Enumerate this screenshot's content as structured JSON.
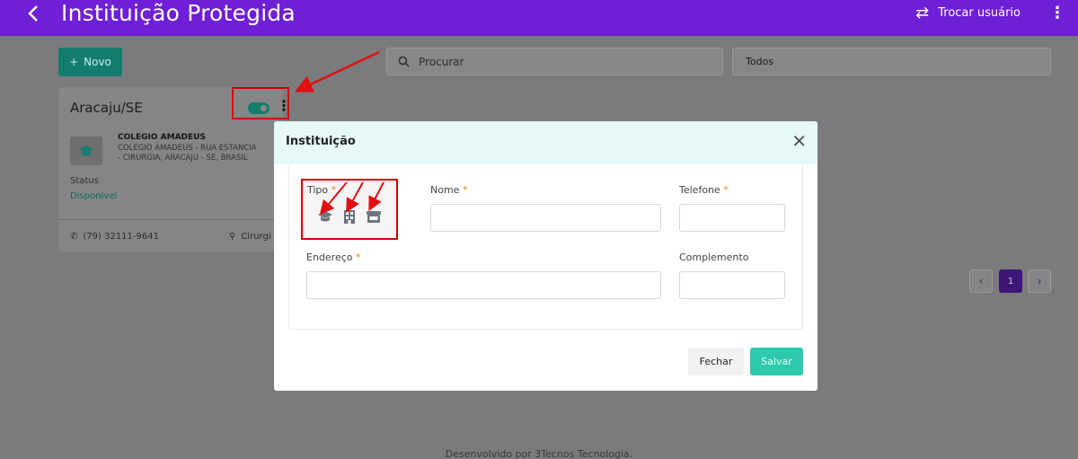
{
  "header": {
    "title": "Instituição Protegida",
    "switch_user": "Trocar usuário"
  },
  "toolbar": {
    "new_label": "Novo",
    "search_placeholder": "Procurar",
    "filter_value": "Todos"
  },
  "card": {
    "title": "Aracaju/SE",
    "institution_name": "COLEGIO AMADEUS",
    "institution_address": "COLEGIO AMADEUS - RUA ESTANCIA",
    "institution_address_2": "- CIRURGIA, ARACAJU - SE, BRASIL",
    "status_label": "Status",
    "status_value": "Disponível",
    "phone": "(79) 32111-9641",
    "city": "Cirurgi"
  },
  "pagination": {
    "current": "1"
  },
  "footer": {
    "text": "Desenvolvido por 3Tecnos Tecnologia."
  },
  "modal": {
    "title": "Instituição",
    "fields": {
      "tipo": "Tipo",
      "nome": "Nome",
      "telefone": "Telefone",
      "endereco": "Endereço",
      "complemento": "Complemento"
    },
    "required_mark": "*",
    "type_icons": [
      "graduation-cap-icon",
      "building-icon",
      "store-icon"
    ],
    "buttons": {
      "close": "Fechar",
      "save": "Salvar"
    }
  },
  "colors": {
    "header_bg": "#6f1fd6",
    "accent_green": "#2ec9ad",
    "annotation_red": "#d50000"
  }
}
